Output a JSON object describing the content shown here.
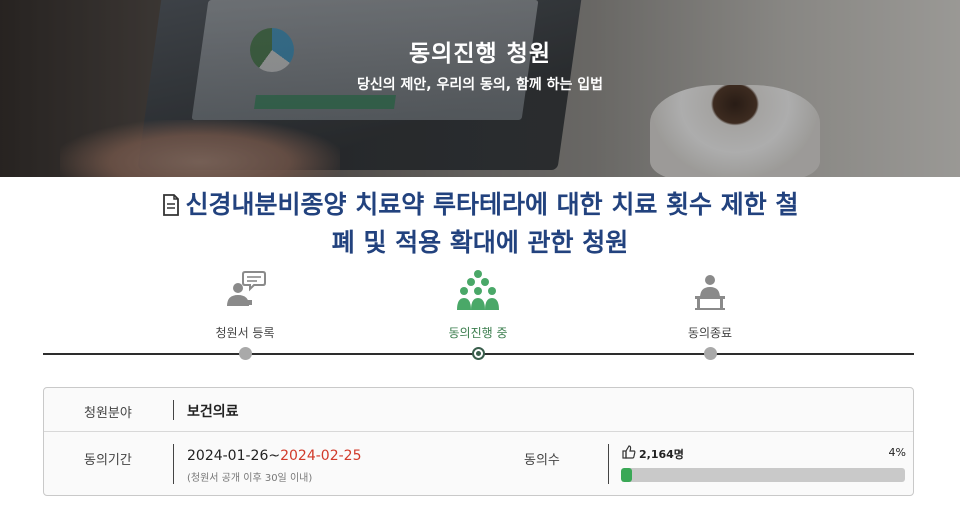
{
  "hero": {
    "title": "동의진행 청원",
    "subtitle": "당신의 제안, 우리의 동의, 함께 하는 입법"
  },
  "petition": {
    "title_line1": "신경내분비종양 치료약 루타테라에 대한 치료 횟수 제한 철",
    "title_line2": "폐 및 적용 확대에 관한 청원",
    "icon": "document-icon",
    "title_color": "#22427e"
  },
  "steps": [
    {
      "label": "청원서 등록",
      "icon": "speaking-person-icon",
      "active": false
    },
    {
      "label": "동의진행 중",
      "icon": "group-people-icon",
      "active": true
    },
    {
      "label": "동의종료",
      "icon": "podium-person-icon",
      "active": false
    }
  ],
  "info": {
    "field_label": "청원분야",
    "field_value": "보건의료",
    "period_label": "동의기간",
    "period_start": "2024-01-26",
    "period_sep": "~",
    "period_end": "2024-02-25",
    "period_note": "(청원서 공개 이후 30일 이내)",
    "agree_label": "동의수",
    "agree_count": "2,164명",
    "agree_percent_text": "4%",
    "agree_progress": 0.04,
    "agree_icon": "thumbs-up-icon",
    "progress_color": "#3aa856",
    "end_date_color": "#d13a2a"
  }
}
